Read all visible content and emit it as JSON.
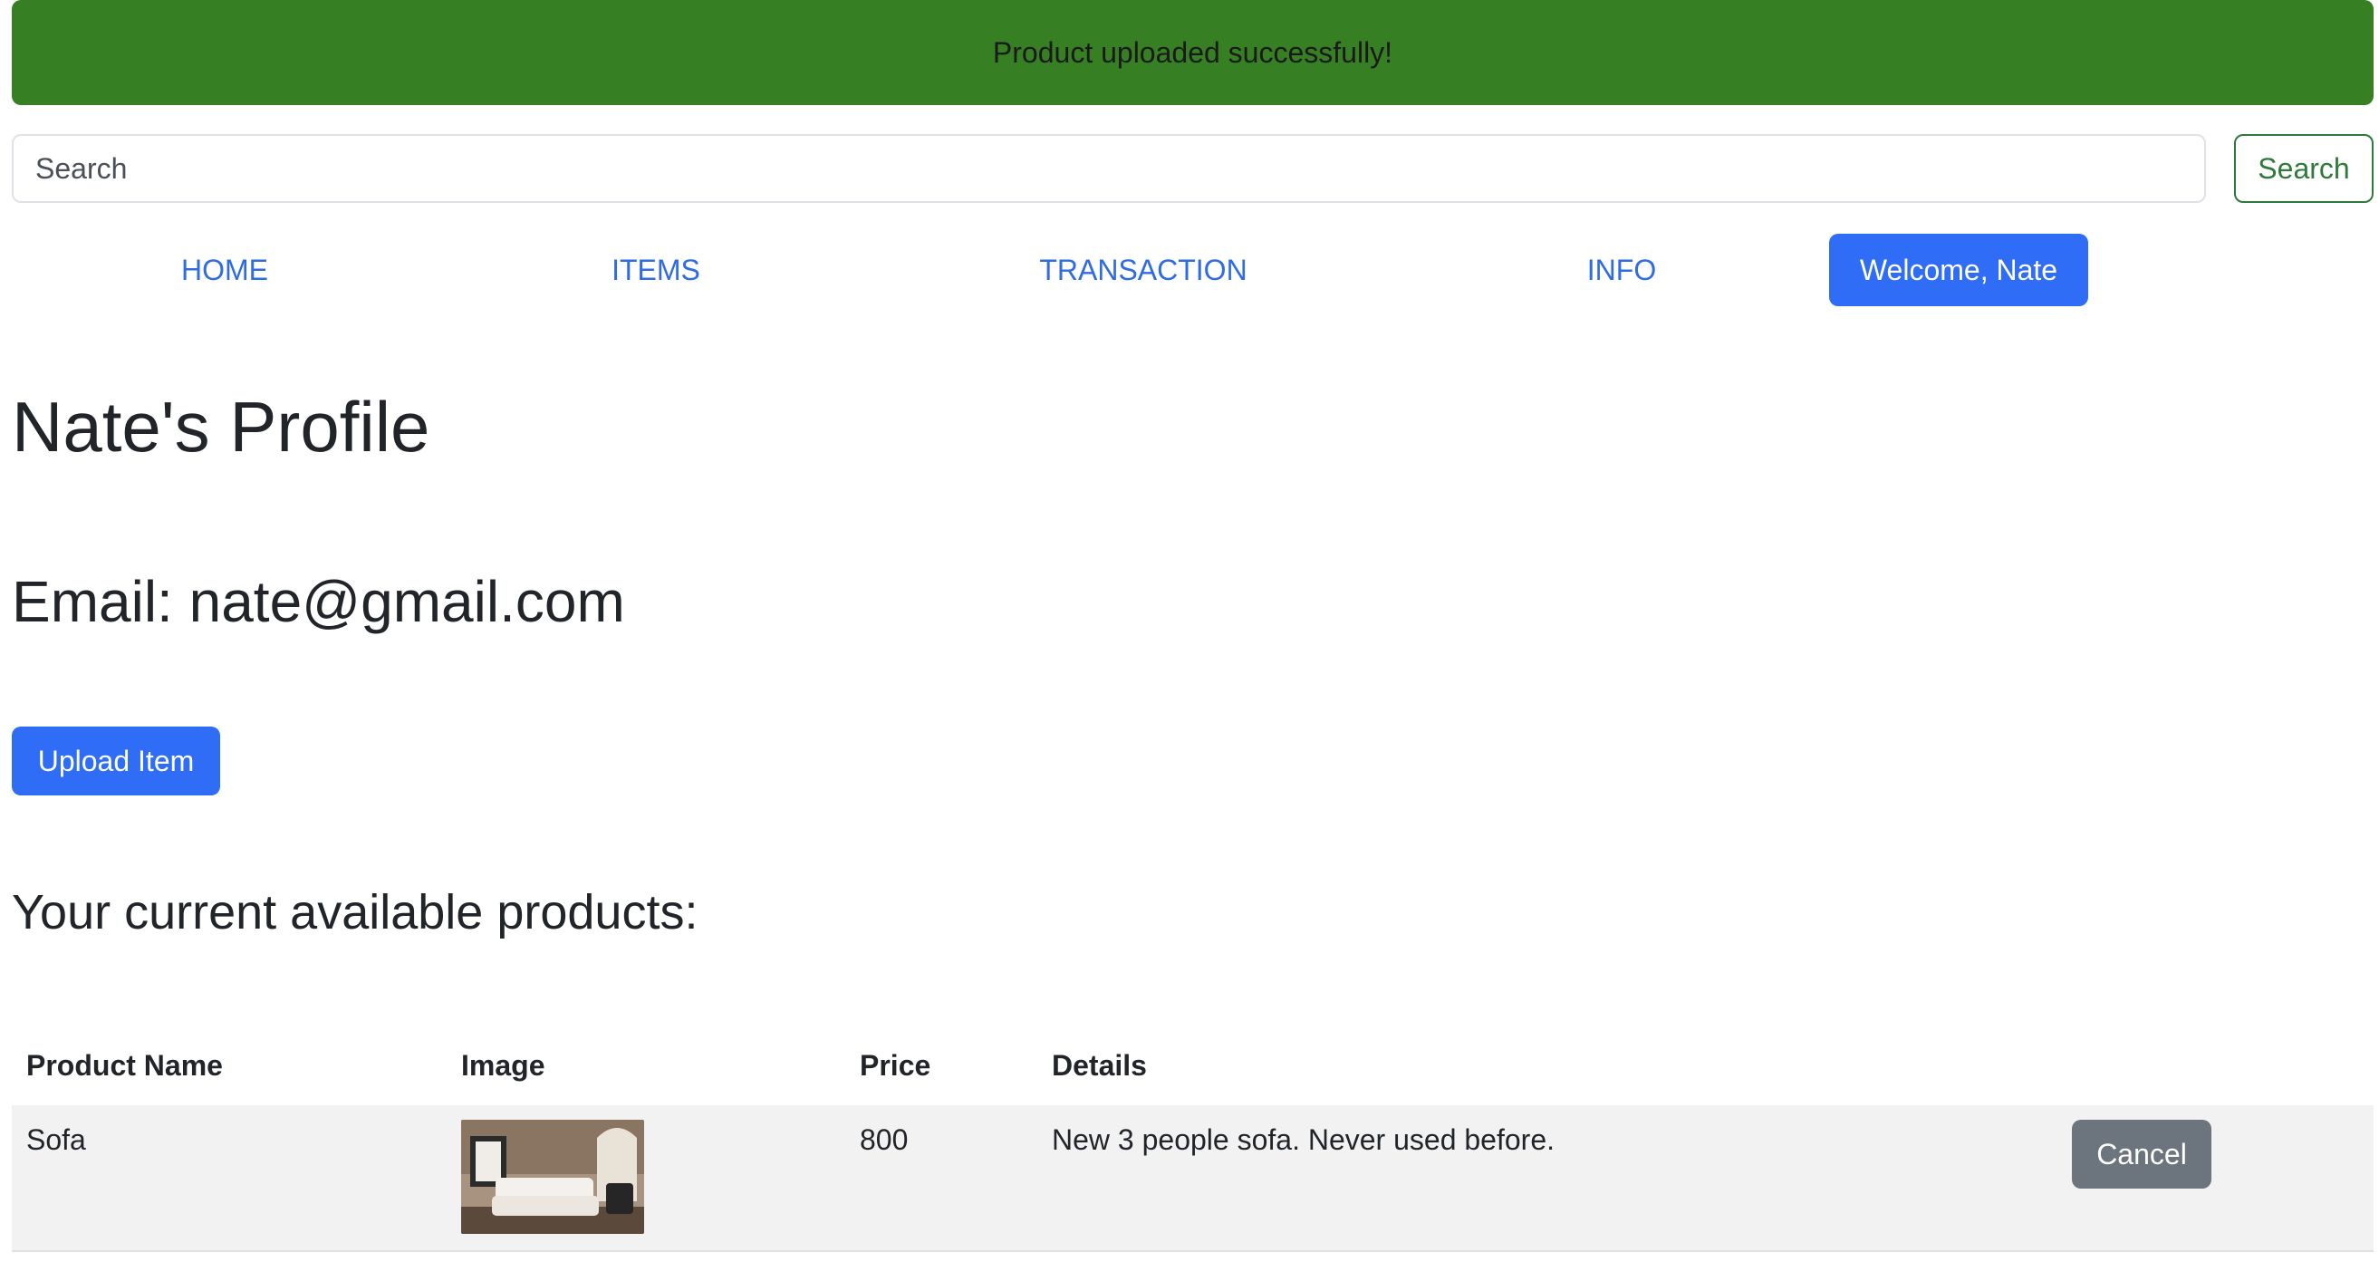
{
  "alert": {
    "message": "Product uploaded successfully!"
  },
  "search": {
    "placeholder": "Search",
    "button_label": "Search"
  },
  "nav": {
    "items": [
      {
        "label": "HOME"
      },
      {
        "label": "ITEMS"
      },
      {
        "label": "TRANSACTION"
      },
      {
        "label": "INFO"
      }
    ],
    "welcome_label": "Welcome, Nate"
  },
  "profile": {
    "title": "Nate's Profile",
    "email_line": "Email: nate@gmail.com",
    "upload_button_label": "Upload Item"
  },
  "products": {
    "heading": "Your current available products:",
    "columns": [
      "Product Name",
      "Image",
      "Price",
      "Details"
    ],
    "rows": [
      {
        "name": "Sofa",
        "image_icon": "sofa-photo",
        "price": "800",
        "details": "New 3 people sofa. Never used before.",
        "action_label": "Cancel"
      }
    ]
  },
  "colors": {
    "alert_bg": "#367f22",
    "primary": "#2f6df6",
    "link": "#2f6be5",
    "search_button": "#2f7a3a",
    "secondary": "#6c757d",
    "row_bg": "#f2f2f2"
  }
}
